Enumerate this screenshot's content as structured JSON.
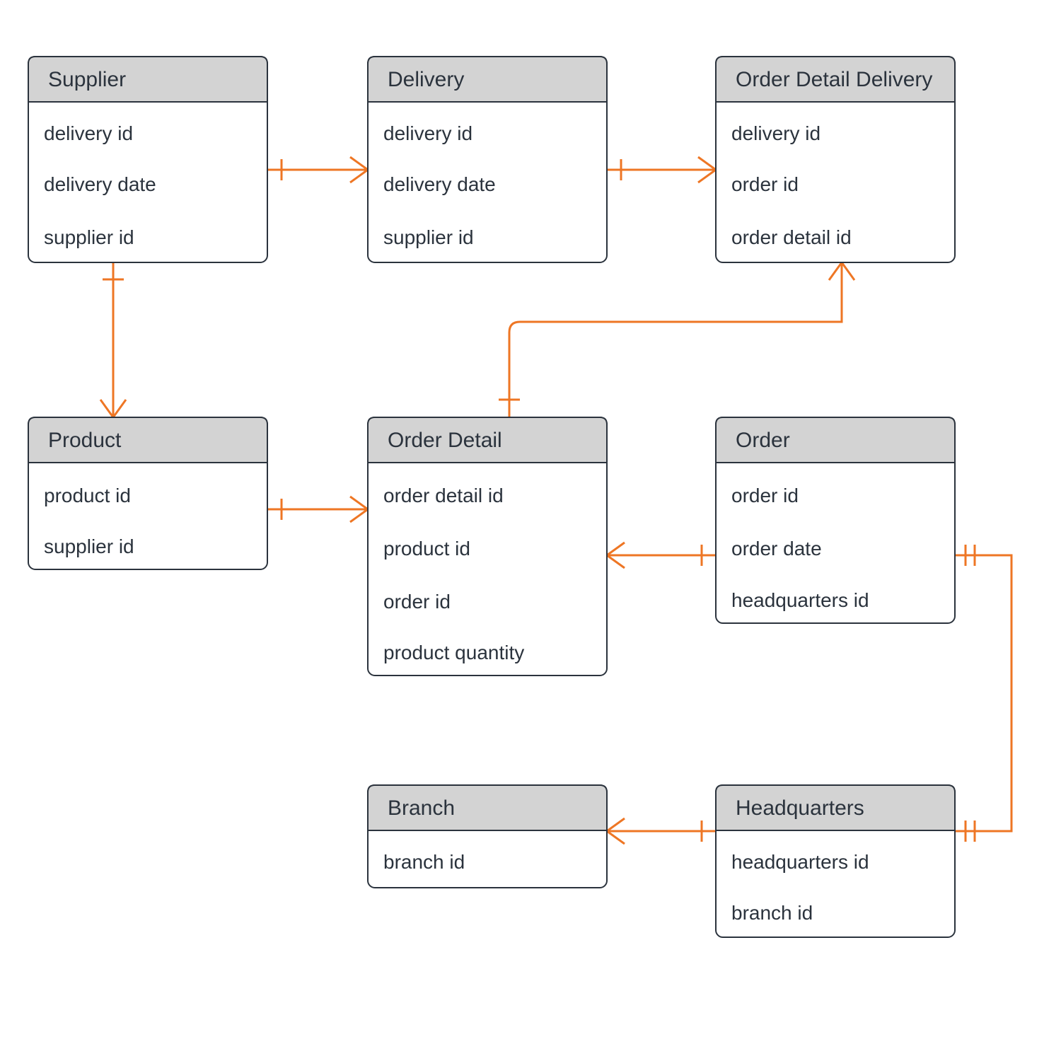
{
  "diagram": {
    "type": "entity-relationship",
    "entities": {
      "supplier": {
        "title": "Supplier",
        "attrs": [
          "delivery id",
          "delivery date",
          "supplier id"
        ]
      },
      "delivery": {
        "title": "Delivery",
        "attrs": [
          "delivery id",
          "delivery date",
          "supplier id"
        ]
      },
      "order_detail_delivery": {
        "title": "Order Detail Delivery",
        "attrs": [
          "delivery id",
          "order id",
          "order detail id"
        ]
      },
      "product": {
        "title": "Product",
        "attrs": [
          "product id",
          "supplier id"
        ]
      },
      "order_detail": {
        "title": "Order Detail",
        "attrs": [
          "order detail id",
          "product id",
          "order id",
          "product quantity"
        ]
      },
      "order": {
        "title": "Order",
        "attrs": [
          "order id",
          "order date",
          "headquarters id"
        ]
      },
      "branch": {
        "title": "Branch",
        "attrs": [
          "branch id"
        ]
      },
      "headquarters": {
        "title": "Headquarters",
        "attrs": [
          "headquarters id",
          "branch id"
        ]
      }
    },
    "relationships": [
      {
        "from": "supplier",
        "to": "delivery",
        "type": "one-to-many"
      },
      {
        "from": "delivery",
        "to": "order_detail_delivery",
        "type": "one-to-many"
      },
      {
        "from": "supplier",
        "to": "product",
        "type": "one-to-many"
      },
      {
        "from": "product",
        "to": "order_detail",
        "type": "one-to-many"
      },
      {
        "from": "order",
        "to": "order_detail",
        "type": "one-to-many"
      },
      {
        "from": "order_detail",
        "to": "order_detail_delivery",
        "type": "one-to-many"
      },
      {
        "from": "headquarters",
        "to": "order",
        "type": "one-to-one"
      },
      {
        "from": "headquarters",
        "to": "branch",
        "type": "one-to-many"
      }
    ]
  }
}
